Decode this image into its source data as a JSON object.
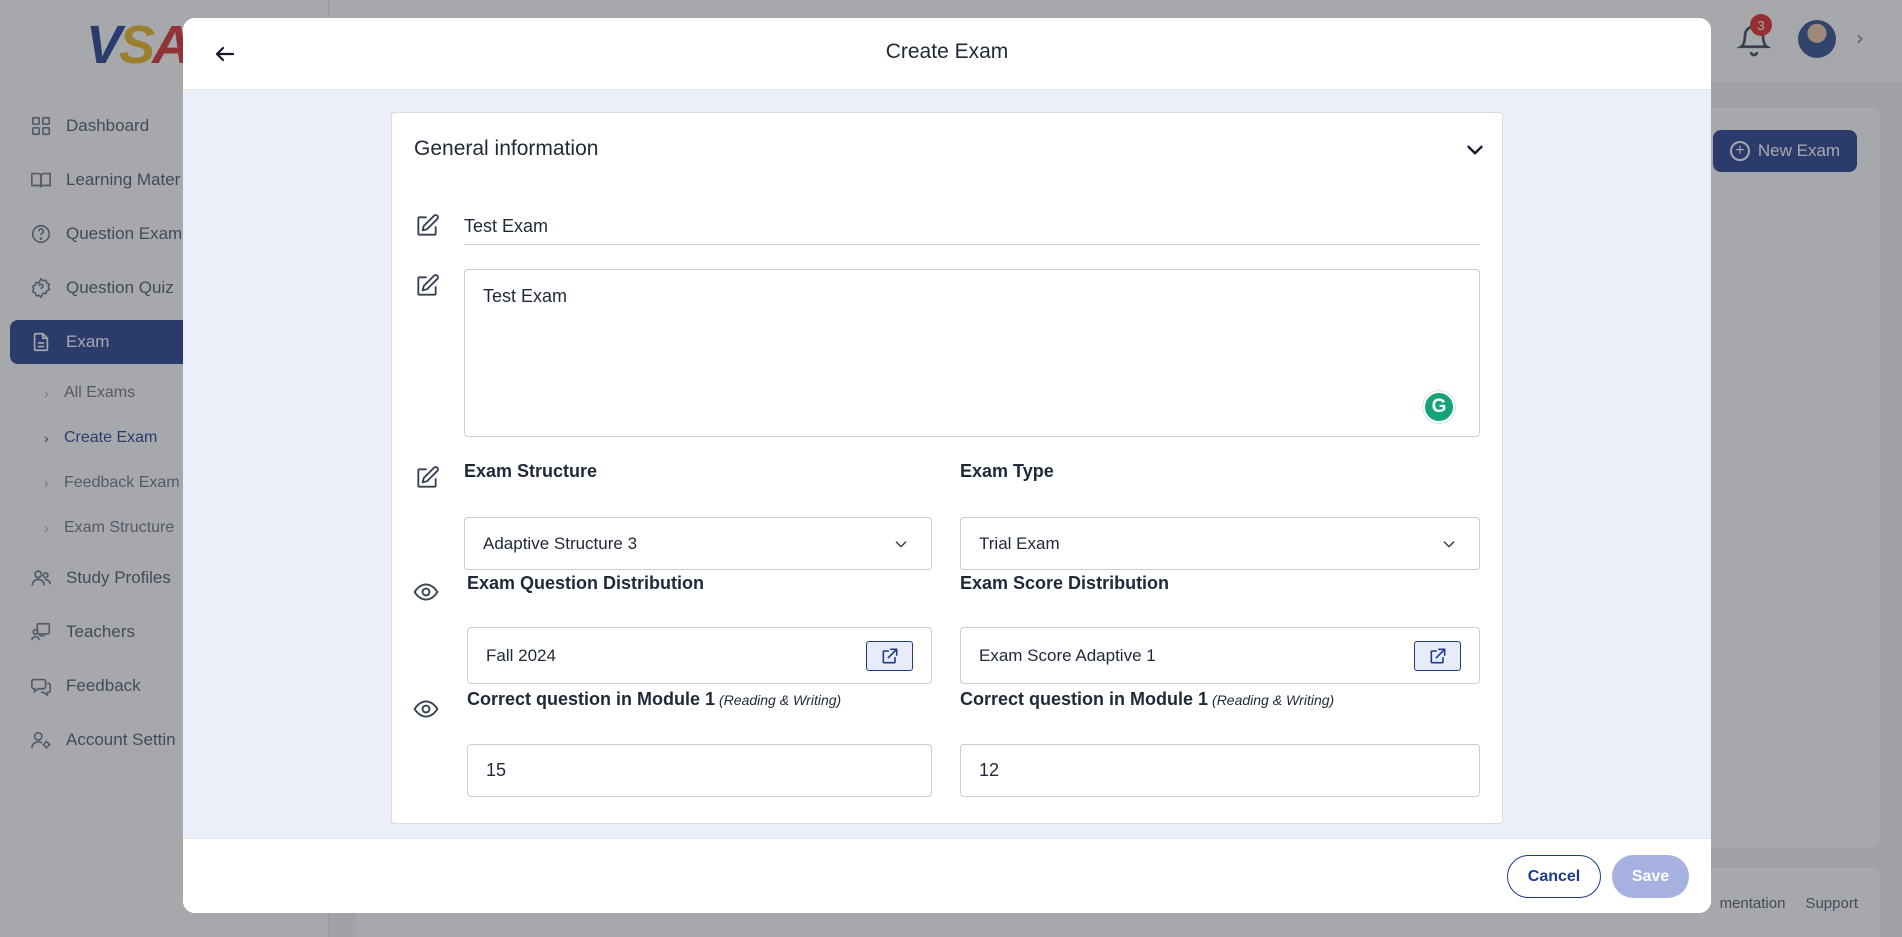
{
  "app": {
    "logo_text": [
      "V",
      "S",
      "A"
    ],
    "nav": [
      {
        "label": "Dashboard",
        "icon": "grid-icon"
      },
      {
        "label": "Learning Mater",
        "icon": "book-icon"
      },
      {
        "label": "Question Exam",
        "icon": "help-circle-icon"
      },
      {
        "label": "Question Quiz",
        "icon": "badge-help-icon"
      },
      {
        "label": "Exam",
        "icon": "file-icon",
        "active": true
      },
      {
        "label": "Study Profiles",
        "icon": "users-icon"
      },
      {
        "label": "Teachers",
        "icon": "teacher-icon"
      },
      {
        "label": "Feedback",
        "icon": "chat-icon"
      },
      {
        "label": "Account Settin",
        "icon": "user-cog-icon"
      }
    ],
    "exam_subnav": [
      {
        "label": "All Exams"
      },
      {
        "label": "Create Exam",
        "active": true
      },
      {
        "label": "Feedback Exam"
      },
      {
        "label": "Exam Structure"
      }
    ],
    "notifications_count": "3",
    "new_exam_label": "New Exam",
    "footer_links": [
      "mentation",
      "Support"
    ]
  },
  "modal": {
    "title": "Create Exam",
    "section_title": "General information",
    "exam_name": "Test Exam",
    "exam_description": "Test Exam",
    "grammarly_letter": "G",
    "exam_structure": {
      "label": "Exam Structure",
      "value": "Adaptive Structure 3"
    },
    "exam_type": {
      "label": "Exam Type",
      "value": "Trial Exam"
    },
    "question_distribution": {
      "label": "Exam Question Distribution",
      "value": "Fall 2024"
    },
    "score_distribution": {
      "label": "Exam Score Distribution",
      "value": "Exam Score Adaptive 1"
    },
    "correct_module_left": {
      "label": "Correct question in Module 1",
      "hint": "(Reading & Writing)",
      "value": "15"
    },
    "correct_module_right": {
      "label": "Correct question in Module 1",
      "hint": "(Reading & Writing)",
      "value": "12"
    },
    "cancel_label": "Cancel",
    "save_label": "Save"
  },
  "colors": {
    "brand": "#1e3a8a",
    "save_disabled": "#a6b1e1",
    "modal_bg": "#eceef9",
    "badge": "#dc2626"
  }
}
